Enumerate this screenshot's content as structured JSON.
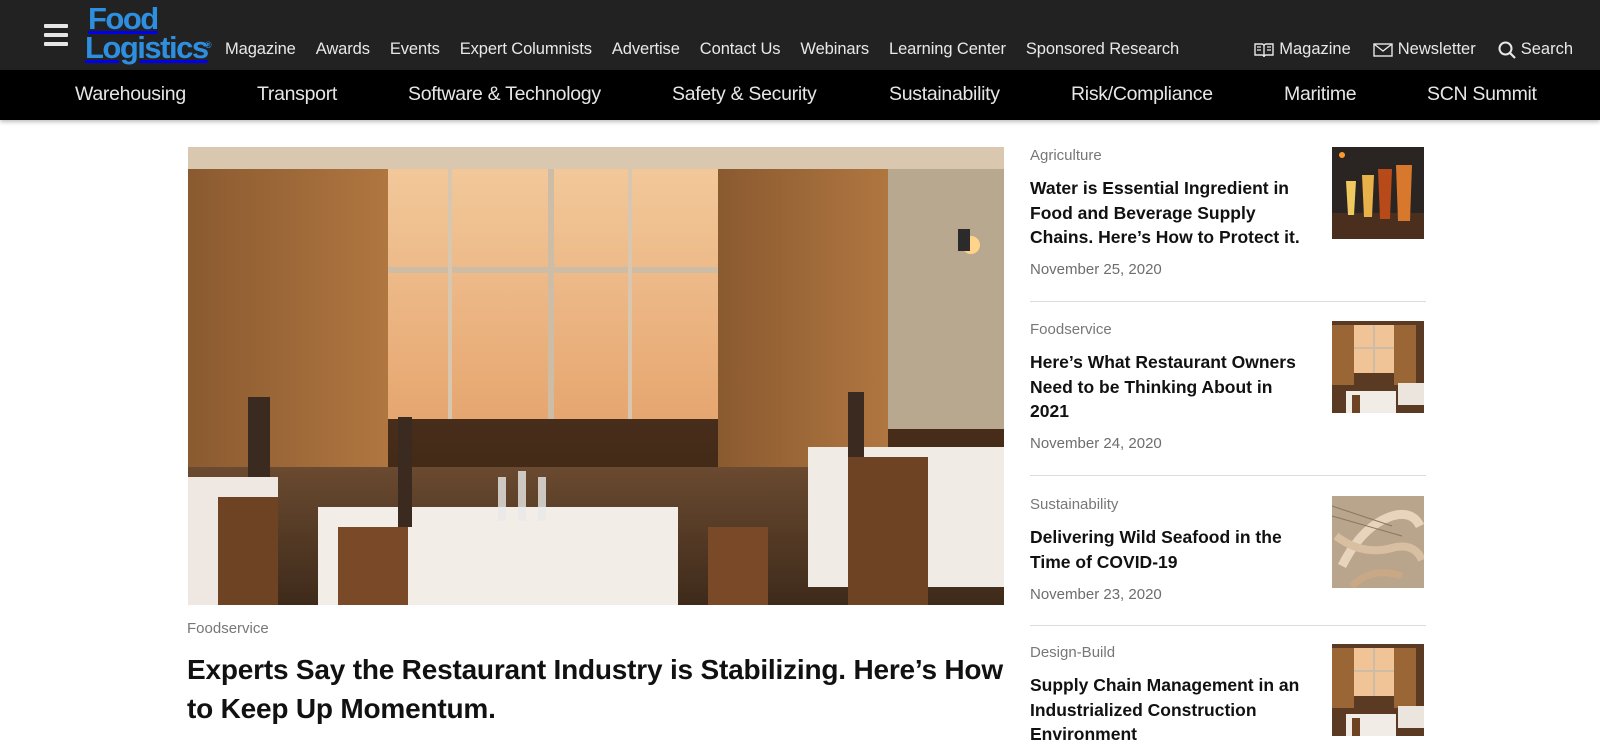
{
  "brand": {
    "line1": "Food",
    "line2": "Logistics",
    "mark": "®",
    "color": "#2e8fe0"
  },
  "top_nav": {
    "links": [
      "Magazine",
      "Awards",
      "Events",
      "Expert Columnists",
      "Advertise",
      "Contact Us",
      "Webinars",
      "Learning Center",
      "Sponsored Research"
    ],
    "right": {
      "magazine": "Magazine",
      "newsletter": "Newsletter",
      "search": "Search"
    },
    "icons": {
      "menu": "hamburger-icon",
      "magazine": "book-icon",
      "newsletter": "envelope-icon",
      "search": "search-icon"
    }
  },
  "category_nav": [
    "Warehousing",
    "Transport",
    "Software & Technology",
    "Safety & Security",
    "Sustainability",
    "Risk/Compliance",
    "Maritime",
    "SCN Summit"
  ],
  "featured": {
    "category": "Foodservice",
    "title": "Experts Say the Restaurant Industry is Stabilizing. Here’s How to Keep Up Momentum."
  },
  "sidebar": [
    {
      "category": "Agriculture",
      "title": "Water is Essential Ingredient in Food and Beverage Supply Chains. Here’s How to Protect it.",
      "date": "November 25, 2020",
      "thumb": "beer-flight"
    },
    {
      "category": "Foodservice",
      "title": "Here’s What Restaurant Owners Need to be Thinking About in 2021",
      "date": "November 24, 2020",
      "thumb": "restaurant"
    },
    {
      "category": "Sustainability",
      "title": "Delivering Wild Seafood in the Time of COVID-19",
      "date": "November 23, 2020",
      "thumb": "shrimp"
    },
    {
      "category": "Design-Build",
      "title": "Supply Chain Management in an Industrialized Construction Environment",
      "date": "",
      "thumb": "restaurant"
    }
  ],
  "colors": {
    "topbar": "#222222",
    "catbar": "#000000",
    "accent": "#2e8fe0"
  }
}
